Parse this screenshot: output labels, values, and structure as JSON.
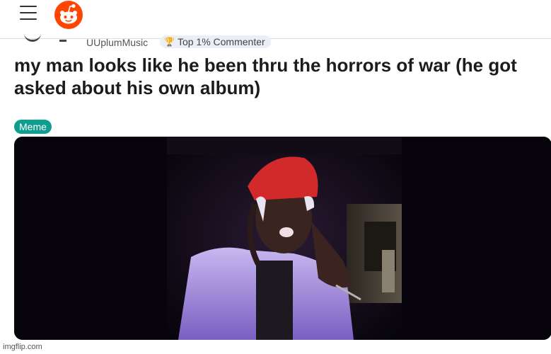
{
  "header": {
    "menu_icon": "hamburger-menu-icon",
    "logo_icon": "reddit-snoo-logo-icon",
    "brand_color": "#ff4500"
  },
  "post": {
    "author": "UUplumMusic",
    "badge": "Top 1% Commenter",
    "badge_icon": "commenter-badge-icon",
    "title": "my man looks like he been thru the horrors of war (he got asked about his own album)",
    "flair": "Meme",
    "flair_color": "#0e9e8f"
  },
  "watermark": "imgflip.com"
}
